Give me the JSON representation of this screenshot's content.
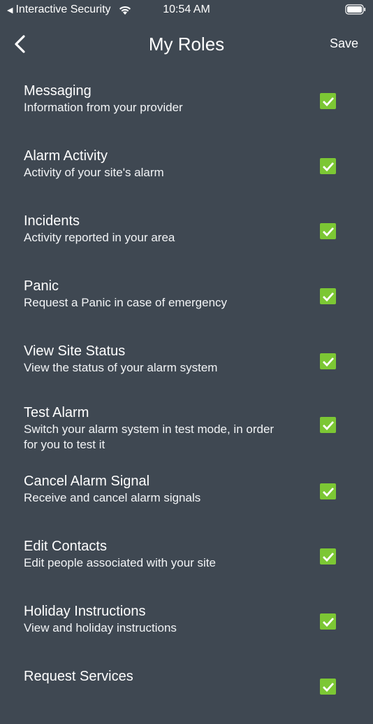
{
  "status_bar": {
    "carrier": "Interactive Security",
    "time": "10:54 AM"
  },
  "nav": {
    "title": "My Roles",
    "save_label": "Save"
  },
  "roles": [
    {
      "title": "Messaging",
      "description": "Information from your provider",
      "checked": true
    },
    {
      "title": "Alarm Activity",
      "description": "Activity of your site's alarm",
      "checked": true
    },
    {
      "title": "Incidents",
      "description": "Activity reported in your area",
      "checked": true
    },
    {
      "title": "Panic",
      "description": "Request a Panic in case of emergency",
      "checked": true
    },
    {
      "title": "View Site Status",
      "description": "View the status of your alarm system",
      "checked": true
    },
    {
      "title": "Test Alarm",
      "description": "Switch your alarm system in test mode,  in order for you to test it",
      "checked": true
    },
    {
      "title": "Cancel Alarm Signal",
      "description": "Receive and cancel alarm signals",
      "checked": true
    },
    {
      "title": "Edit Contacts",
      "description": "Edit people associated with your site",
      "checked": true
    },
    {
      "title": "Holiday Instructions",
      "description": "View and holiday instructions",
      "checked": true
    },
    {
      "title": "Request Services",
      "description": "",
      "checked": true
    }
  ],
  "colors": {
    "background": "#3f4852",
    "checkbox_green": "#7cc734",
    "text": "#ffffff"
  }
}
